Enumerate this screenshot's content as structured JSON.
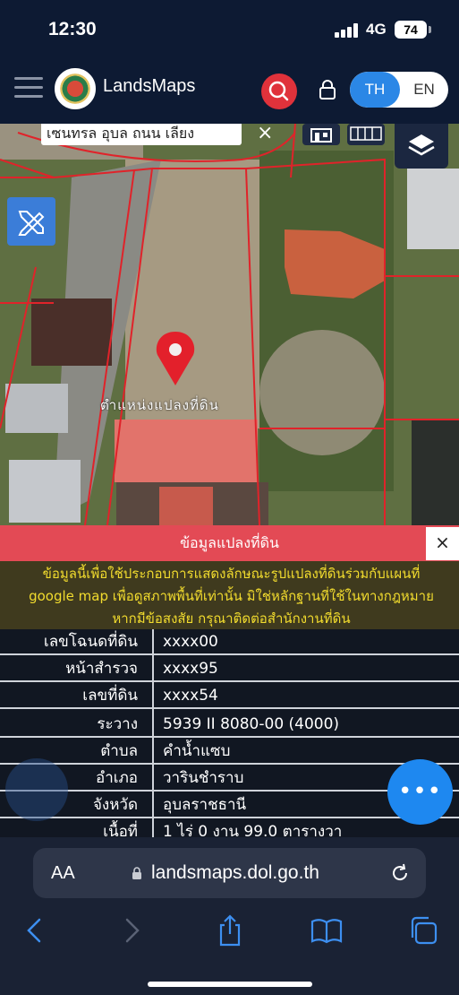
{
  "status_bar": {
    "time": "12:30",
    "network": "4G",
    "battery": "74"
  },
  "header": {
    "brand": "LandsMaps",
    "lang_th": "TH",
    "lang_en": "EN",
    "icons": {
      "menu": "hamburger-icon",
      "search": "search-icon",
      "lock": "lock-icon"
    }
  },
  "map": {
    "search_text": "เซนทรล อุบล ถนน เลียง",
    "parcel_label": "ตำแหน่งแปลงที่ดิน",
    "icons": {
      "edit": "pencil-ruler-icon",
      "layers": "layers-icon",
      "pin": "location-pin-icon",
      "home": "building-icon",
      "grid": "grid-icon"
    }
  },
  "panel": {
    "title": "ข้อมูลแปลงที่ดิน",
    "close": "×",
    "notice_lines": [
      "ข้อมูลนี้เพื่อใช้ประกอบการแสดงลักษณะรูปแปลงที่ดินร่วมกับแผนที่",
      "google map เพื่อดูสภาพพื้นที่เท่านั้น มิใช่หลักฐานที่ใช้ในทางกฎหมาย",
      "หากมีข้อสงสัย กรุณาติดต่อสำนักงานที่ดิน"
    ],
    "rows": [
      {
        "key": "เลขโฉนดที่ดิน",
        "value": "xxxx00"
      },
      {
        "key": "หน้าสำรวจ",
        "value": "xxxx95"
      },
      {
        "key": "เลขที่ดิน",
        "value": "xxxx54"
      },
      {
        "key": "ระวาง",
        "value": "5939 II 8080-00 (4000)"
      },
      {
        "key": "ตำบล",
        "value": "คำน้ำแซบ"
      },
      {
        "key": "อำเภอ",
        "value": "วารินชำราบ"
      },
      {
        "key": "จังหวัด",
        "value": "อุบลราชธานี"
      },
      {
        "key": "เนื้อที่",
        "value": "1 ไร่ 0 งาน 99.0 ตารางวา"
      }
    ]
  },
  "fab": {
    "label": "•••"
  },
  "browser": {
    "aa": "AA",
    "url": "landsmaps.dol.go.th",
    "toolbar": [
      "back-icon",
      "forward-icon",
      "share-icon",
      "bookmarks-icon",
      "tabs-icon"
    ]
  },
  "colors": {
    "header_bg": "#0d1a33",
    "accent_blue": "#2b87e6",
    "panel_red": "#e34a55",
    "notice_yellow": "#f2dc2e"
  }
}
